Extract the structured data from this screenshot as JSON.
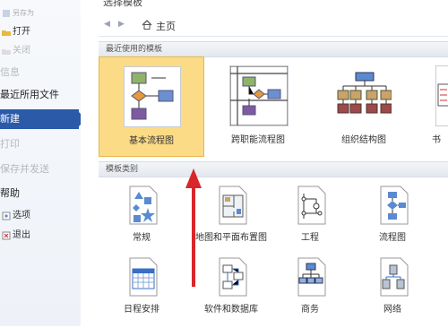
{
  "sidebar": {
    "save": "另存为",
    "open": "打开",
    "close": "关闭",
    "info": "信息",
    "recent": "最近所用文件",
    "new": "新建",
    "print": "打印",
    "save_send": "保存并发送",
    "help": "帮助",
    "options": "选项",
    "exit": "退出"
  },
  "main": {
    "title": "选择模板",
    "nav": {
      "back": "◀",
      "forward": "▶",
      "home": "主页"
    },
    "recent_section": "最近使用的模板",
    "recent_templates": [
      {
        "label": "基本流程图"
      },
      {
        "label": "跨职能流程图"
      },
      {
        "label": "组织结构图"
      },
      {
        "label": "书"
      }
    ],
    "category_section": "模板类别",
    "categories": [
      {
        "label": "常规",
        "icon": "general-shapes-icon"
      },
      {
        "label": "地图和平面布置图",
        "icon": "maps-floorplans-icon"
      },
      {
        "label": "工程",
        "icon": "engineering-icon"
      },
      {
        "label": "流程图",
        "icon": "flowchart-icon"
      },
      {
        "label": "日程安排",
        "icon": "schedule-icon"
      },
      {
        "label": "软件和数据库",
        "icon": "software-database-icon"
      },
      {
        "label": "商务",
        "icon": "business-icon"
      },
      {
        "label": "网络",
        "icon": "network-icon"
      }
    ]
  },
  "colors": {
    "accent": "#2a5aa8",
    "selected": "#fcdb87",
    "annotation": "#d8262a"
  }
}
